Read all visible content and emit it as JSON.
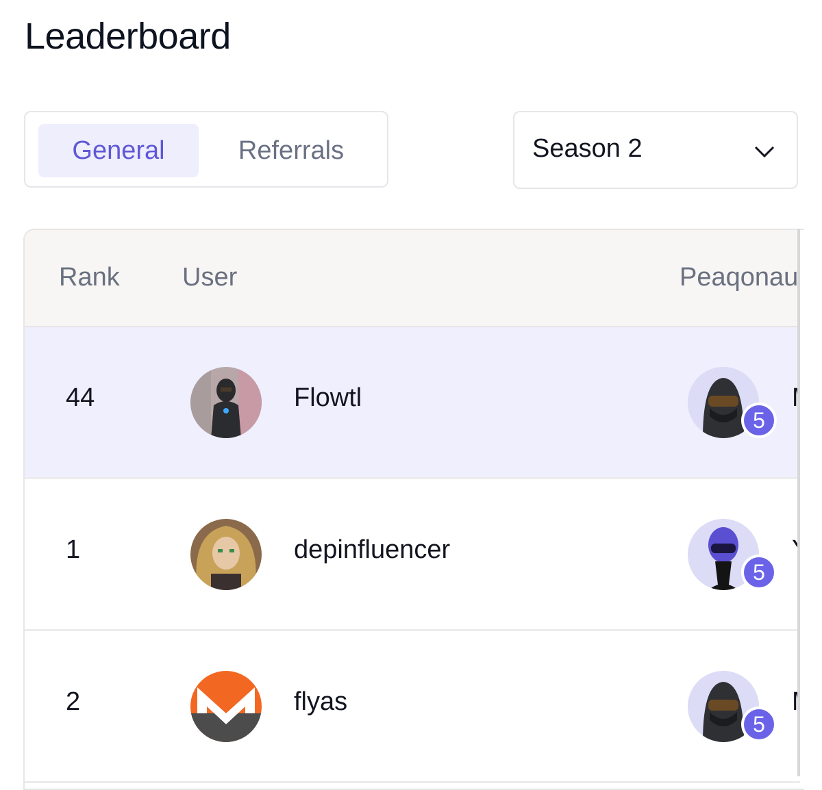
{
  "title": "Leaderboard",
  "tabs": [
    {
      "label": "General",
      "active": true
    },
    {
      "label": "Referrals",
      "active": false
    }
  ],
  "season_select": {
    "value": "Season 2",
    "icon": "chevron-down-icon"
  },
  "table": {
    "headers": {
      "rank": "Rank",
      "user": "User",
      "peaqonaut": "Peaqonau"
    },
    "rows": [
      {
        "rank": "44",
        "user": "Flowtl",
        "badge": "5",
        "trailing": "M",
        "highlight": true
      },
      {
        "rank": "1",
        "user": "depinfluencer",
        "badge": "5",
        "trailing": "Y",
        "highlight": false
      },
      {
        "rank": "2",
        "user": "flyas",
        "badge": "5",
        "trailing": "M",
        "highlight": false
      }
    ]
  },
  "colors": {
    "accent": "#6a63e8",
    "active_tab_bg": "#eeeefd",
    "highlight_row": "#efeffd",
    "monero_orange": "#f26822"
  }
}
